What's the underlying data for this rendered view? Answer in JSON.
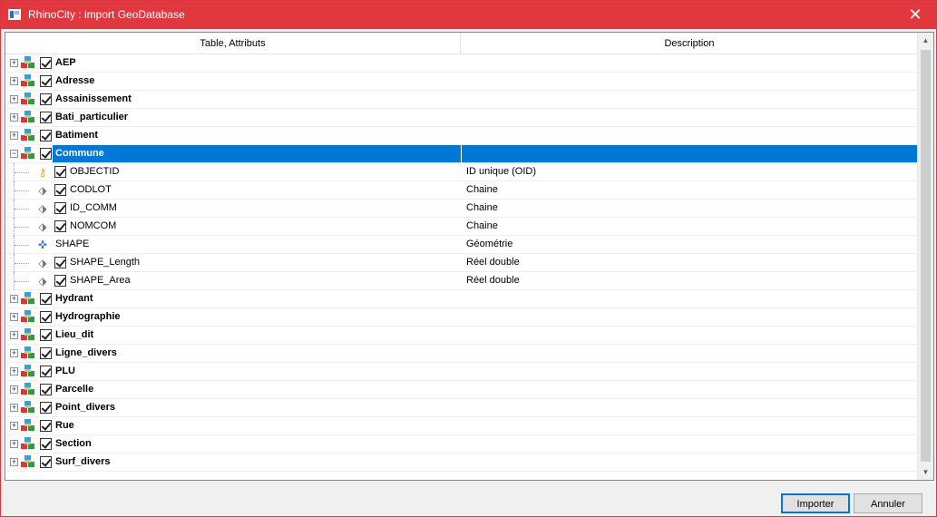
{
  "window": {
    "title": "RhinoCity : import GeoDatabase"
  },
  "columns": [
    "Table, Attributs",
    "Description"
  ],
  "rows": [
    {
      "kind": "table",
      "name": "AEP",
      "desc": "",
      "expanded": false,
      "checked": true
    },
    {
      "kind": "table",
      "name": "Adresse",
      "desc": "",
      "expanded": false,
      "checked": true
    },
    {
      "kind": "table",
      "name": "Assainissement",
      "desc": "",
      "expanded": false,
      "checked": true
    },
    {
      "kind": "table",
      "name": "Bati_particulier",
      "desc": "",
      "expanded": false,
      "checked": true
    },
    {
      "kind": "table",
      "name": "Batiment",
      "desc": "",
      "expanded": false,
      "checked": true
    },
    {
      "kind": "table",
      "name": "Commune",
      "desc": "",
      "expanded": true,
      "checked": true,
      "selected": true
    },
    {
      "kind": "field",
      "icon": "key-icon",
      "name": "OBJECTID",
      "desc": "ID unique (OID)",
      "checked": true
    },
    {
      "kind": "field",
      "icon": "tag-icon",
      "name": "CODLOT",
      "desc": "Chaine",
      "checked": true
    },
    {
      "kind": "field",
      "icon": "tag-icon",
      "name": "ID_COMM",
      "desc": "Chaine",
      "checked": true
    },
    {
      "kind": "field",
      "icon": "tag-icon",
      "name": "NOMCOM",
      "desc": "Chaine",
      "checked": true
    },
    {
      "kind": "field",
      "icon": "shape-icon",
      "name": "SHAPE",
      "desc": "Géométrie",
      "checked": false,
      "nocheck": true
    },
    {
      "kind": "field",
      "icon": "tag-icon",
      "name": "SHAPE_Length",
      "desc": "Réel double",
      "checked": true
    },
    {
      "kind": "field",
      "icon": "tag-icon",
      "name": "SHAPE_Area",
      "desc": "Réel double",
      "checked": true
    },
    {
      "kind": "table",
      "name": "Hydrant",
      "desc": "",
      "expanded": false,
      "checked": true
    },
    {
      "kind": "table",
      "name": "Hydrographie",
      "desc": "",
      "expanded": false,
      "checked": true
    },
    {
      "kind": "table",
      "name": "Lieu_dit",
      "desc": "",
      "expanded": false,
      "checked": true
    },
    {
      "kind": "table",
      "name": "Ligne_divers",
      "desc": "",
      "expanded": false,
      "checked": true
    },
    {
      "kind": "table",
      "name": "PLU",
      "desc": "",
      "expanded": false,
      "checked": true
    },
    {
      "kind": "table",
      "name": "Parcelle",
      "desc": "",
      "expanded": false,
      "checked": true
    },
    {
      "kind": "table",
      "name": "Point_divers",
      "desc": "",
      "expanded": false,
      "checked": true
    },
    {
      "kind": "table",
      "name": "Rue",
      "desc": "",
      "expanded": false,
      "checked": true
    },
    {
      "kind": "table",
      "name": "Section",
      "desc": "",
      "expanded": false,
      "checked": true
    },
    {
      "kind": "table",
      "name": "Surf_divers",
      "desc": "",
      "expanded": false,
      "checked": true
    }
  ],
  "buttons": {
    "import": "Importer",
    "cancel": "Annuler"
  },
  "icons": {
    "close": "close-icon",
    "app": "app-icon"
  }
}
